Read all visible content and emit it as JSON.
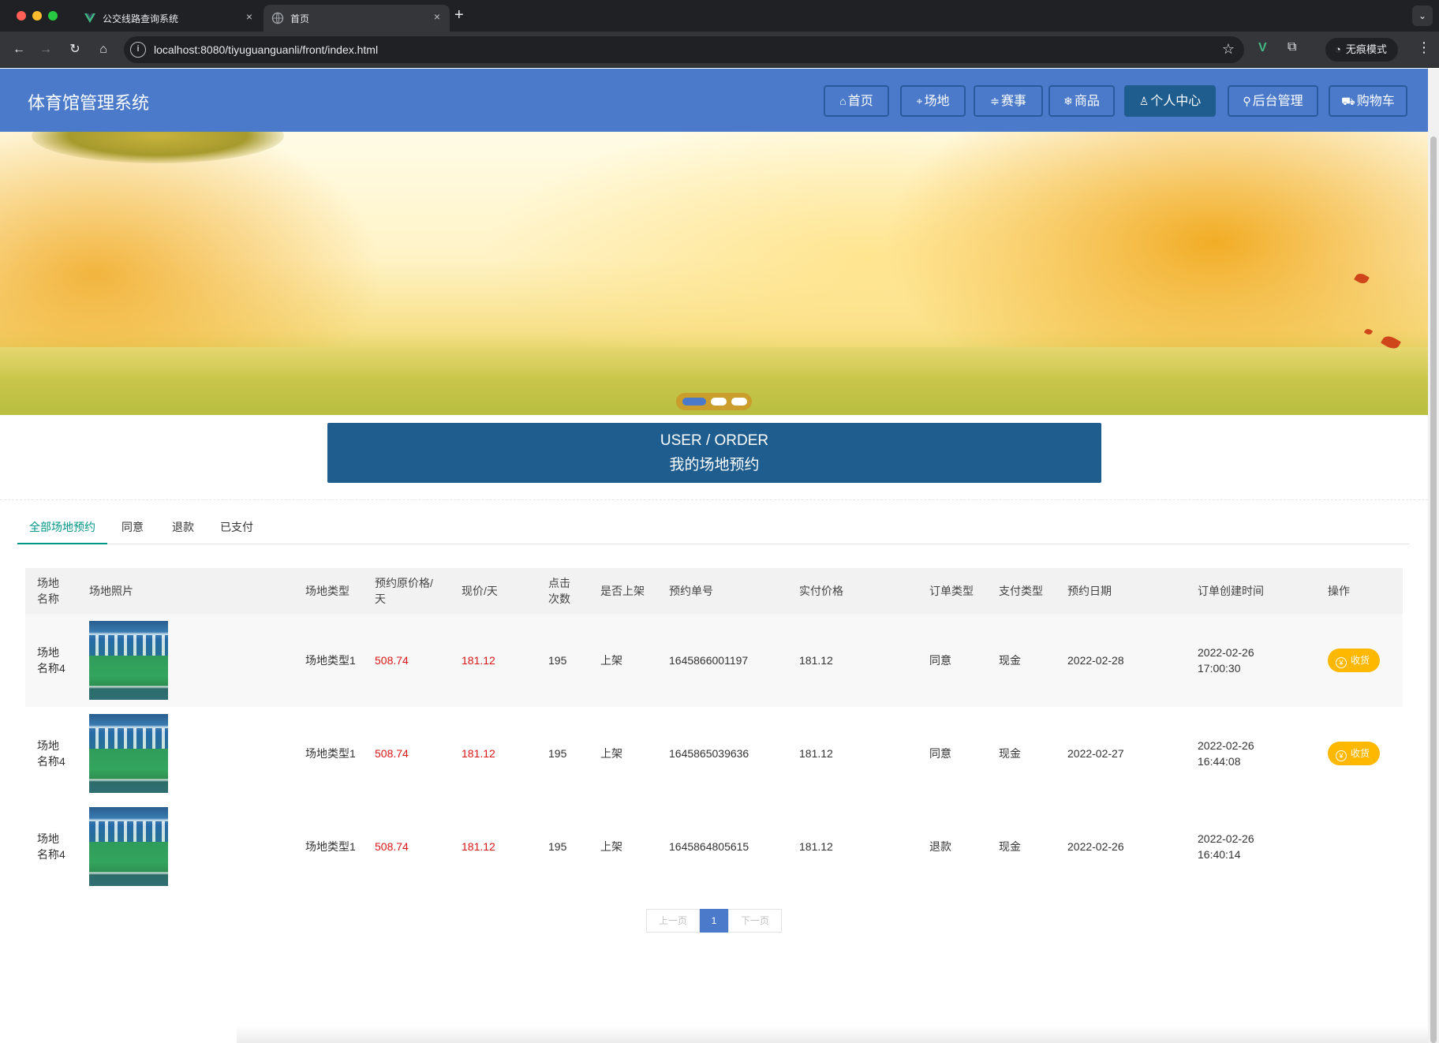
{
  "browser": {
    "tabs": [
      {
        "title": "公交线路查询系统",
        "close": "×"
      },
      {
        "title": "首页",
        "close": "×"
      }
    ],
    "new_tab": "+",
    "url": "localhost:8080/tiyuguanguanli/front/index.html",
    "incognito_label": "无痕模式"
  },
  "site": {
    "title": "体育馆管理系统",
    "nav": [
      {
        "label": "首页",
        "icon": "home-icon"
      },
      {
        "label": "场地",
        "icon": "tag-icon"
      },
      {
        "label": "赛事",
        "icon": "sliders-icon"
      },
      {
        "label": "商品",
        "icon": "snowflake-icon"
      },
      {
        "label": "个人中心",
        "icon": "user-icon",
        "active": true
      },
      {
        "label": "后台管理",
        "icon": "link-icon"
      },
      {
        "label": "购物车",
        "icon": "cart-icon"
      }
    ],
    "nav_active_color": "#1f5d8f",
    "header_color": "#4a7ac9"
  },
  "carousel": {
    "slides": 3,
    "active": 1
  },
  "section": {
    "title_en": "USER / ORDER",
    "title_cn": "我的场地预约"
  },
  "tabs": [
    {
      "label": "全部场地预约",
      "active": true
    },
    {
      "label": "同意"
    },
    {
      "label": "退款"
    },
    {
      "label": "已支付"
    }
  ],
  "table": {
    "headers": [
      "场地名称",
      "场地照片",
      "场地类型",
      "预约原价格/天",
      "现价/天",
      "点击次数",
      "是否上架",
      "预约单号",
      "实付价格",
      "订单类型",
      "支付类型",
      "预约日期",
      "订单创建时间",
      "操作"
    ],
    "rows": [
      {
        "name": "场地名称4",
        "type": "场地类型1",
        "orig_price": "508.74",
        "now_price": "181.12",
        "clicks": "195",
        "shelf": "上架",
        "order_no": "1645866001197",
        "paid": "181.12",
        "order_type": "同意",
        "pay_type": "现金",
        "date": "2022-02-28",
        "created": "2022-02-26 17:00:30",
        "action": "收货"
      },
      {
        "name": "场地名称4",
        "type": "场地类型1",
        "orig_price": "508.74",
        "now_price": "181.12",
        "clicks": "195",
        "shelf": "上架",
        "order_no": "1645865039636",
        "paid": "181.12",
        "order_type": "同意",
        "pay_type": "现金",
        "date": "2022-02-27",
        "created": "2022-02-26 16:44:08",
        "action": "收货"
      },
      {
        "name": "场地名称4",
        "type": "场地类型1",
        "orig_price": "508.74",
        "now_price": "181.12",
        "clicks": "195",
        "shelf": "上架",
        "order_no": "1645864805615",
        "paid": "181.12",
        "order_type": "退款",
        "pay_type": "现金",
        "date": "2022-02-26",
        "created": "2022-02-26 16:40:14",
        "action": ""
      }
    ]
  },
  "pagination": {
    "prev": "上一页",
    "current": "1",
    "next": "下一页"
  }
}
